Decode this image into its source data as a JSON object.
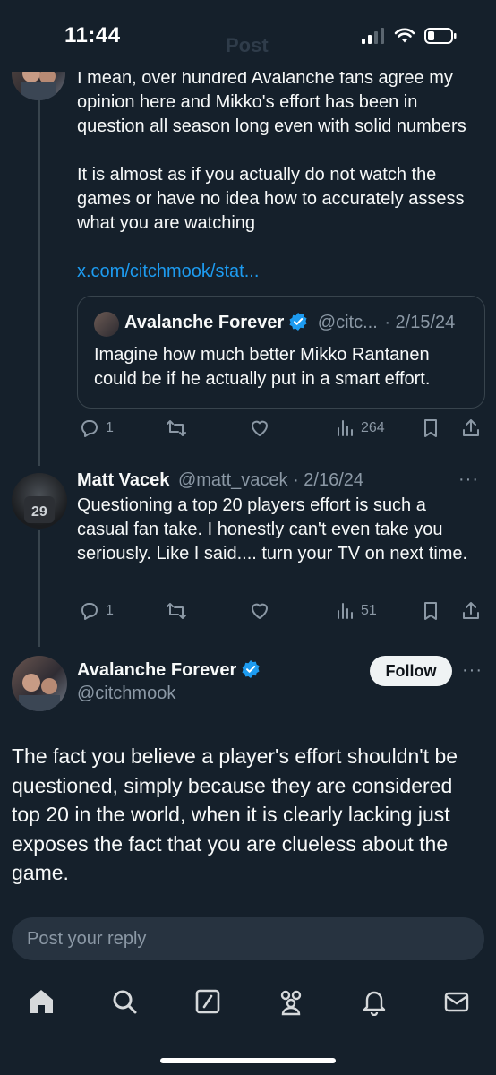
{
  "status_bar": {
    "time": "11:44"
  },
  "header": {
    "back_ghost": "Post"
  },
  "reply_tweet": {
    "text": "I mean, over hundred Avalanche fans agree my opinion here and Mikko's effort has been in question all season long even with solid numbers\n\nIt is almost as if you actually do not watch the games or have no idea how to accurately assess what you are watching",
    "link": "x.com/citchmook/stat...",
    "quote": {
      "name": "Avalanche Forever",
      "handle": "@citc...",
      "date": "· 2/15/24",
      "text": "Imagine how much better Mikko Rantanen could be if he actually put in a smart effort."
    },
    "actions": {
      "replies": "1",
      "views": "264"
    }
  },
  "matt_tweet": {
    "name": "Matt Vacek",
    "handle": "@matt_vacek",
    "date": "· 2/16/24",
    "text": "Questioning a top 20 players effort is such a casual fan take. I honestly can't even take you seriously. Like I said.... turn your TV on next time.",
    "actions": {
      "replies": "1",
      "views": "51"
    }
  },
  "main_tweet": {
    "name": "Avalanche Forever",
    "handle": "@citchmook",
    "follow_label": "Follow",
    "text": "The fact you believe a player's effort shouldn't be questioned, simply because they are considered top 20 in the world, when it is clearly lacking just exposes the fact that you are clueless about the game."
  },
  "reply_input": {
    "placeholder": "Post your reply"
  },
  "colors": {
    "background": "#15202b",
    "accent": "#1d9bf0",
    "muted": "#8b98a5",
    "border": "#38444d"
  },
  "tabbar": {
    "icons": [
      "home-icon",
      "search-icon",
      "grok-icon",
      "communities-icon",
      "notifications-icon",
      "messages-icon"
    ]
  }
}
